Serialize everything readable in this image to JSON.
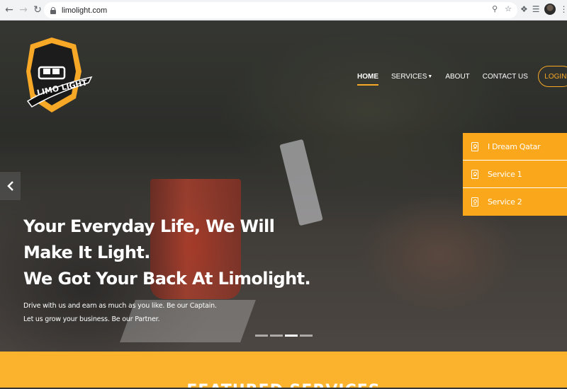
{
  "browser": {
    "url": "limolight.com",
    "icons": [
      "back-icon",
      "forward-icon",
      "reload-icon",
      "lock-icon",
      "key-icon",
      "star-icon",
      "puzzle-icon",
      "playlist-icon",
      "avatar",
      "menu-kebab-icon"
    ]
  },
  "logo": {
    "text": "LIMO LIGHT"
  },
  "nav": {
    "items": [
      {
        "label": "HOME",
        "active": true
      },
      {
        "label": "SERVICES",
        "dropdown": true
      },
      {
        "label": "ABOUT"
      },
      {
        "label": "CONTACT US"
      }
    ],
    "login": "LOGIN"
  },
  "side_menu": {
    "items": [
      {
        "label": "I Dream Qatar",
        "icon": "id-card-icon"
      },
      {
        "label": "Service 1",
        "icon": "id-card-icon"
      },
      {
        "label": "Service 2",
        "icon": "id-card-icon"
      }
    ]
  },
  "hero": {
    "headline": [
      "Your Everyday Life, We Will",
      "Make It Light.",
      "We Got Your Back At Limolight."
    ],
    "subline": [
      "Drive with us and earn as much as you like. Be our Captain.",
      "Let us grow your business. Be our Partner."
    ],
    "slides": 4,
    "active_slide": 3
  },
  "featured": {
    "title": "FEATURED SERVICES"
  },
  "colors": {
    "accent": "#fba71b",
    "featured_bg": "#fbb22d"
  }
}
